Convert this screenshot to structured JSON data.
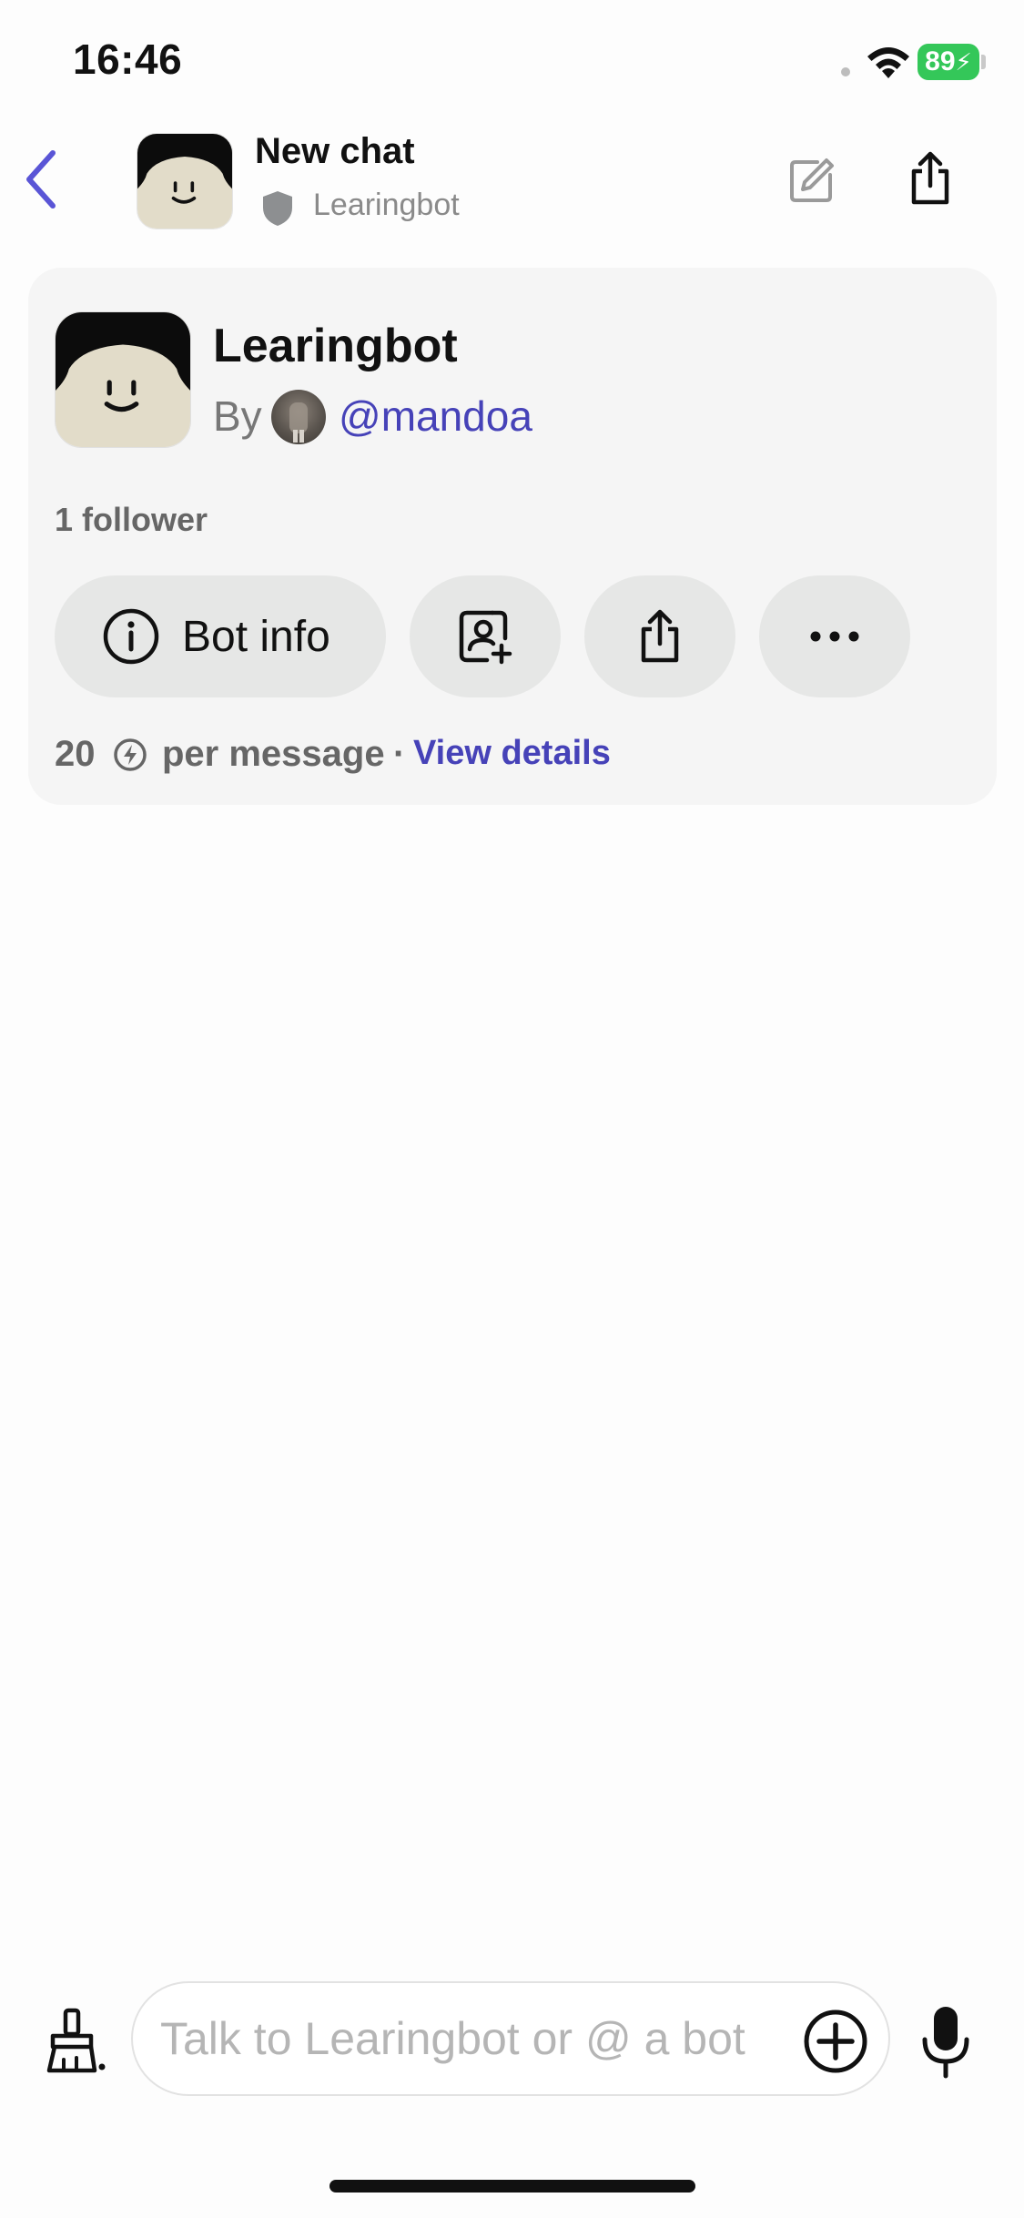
{
  "status_bar": {
    "time": "16:46",
    "battery": "89"
  },
  "header": {
    "title": "New chat",
    "subtitle": "Learingbot"
  },
  "bot_card": {
    "name": "Learingbot",
    "by_label": "By",
    "creator_handle": "@mandoa",
    "followers": "1 follower",
    "actions": {
      "bot_info_label": "Bot info"
    },
    "cost": {
      "amount": "20",
      "per_message": "per message",
      "separator": "·",
      "view_details": "View details"
    }
  },
  "composer": {
    "placeholder": "Talk to Learingbot or @ a bot"
  },
  "colors": {
    "accent": "#4642b8",
    "battery": "#34c759",
    "card_bg": "#f5f5f5",
    "pill_bg": "#e6e7e6"
  },
  "icons": [
    "back-icon",
    "shield-icon",
    "edit-icon",
    "share-icon",
    "info-icon",
    "add-contact-icon",
    "more-icon",
    "bolt-icon",
    "brush-icon",
    "plus-icon",
    "mic-icon",
    "wifi-icon"
  ]
}
